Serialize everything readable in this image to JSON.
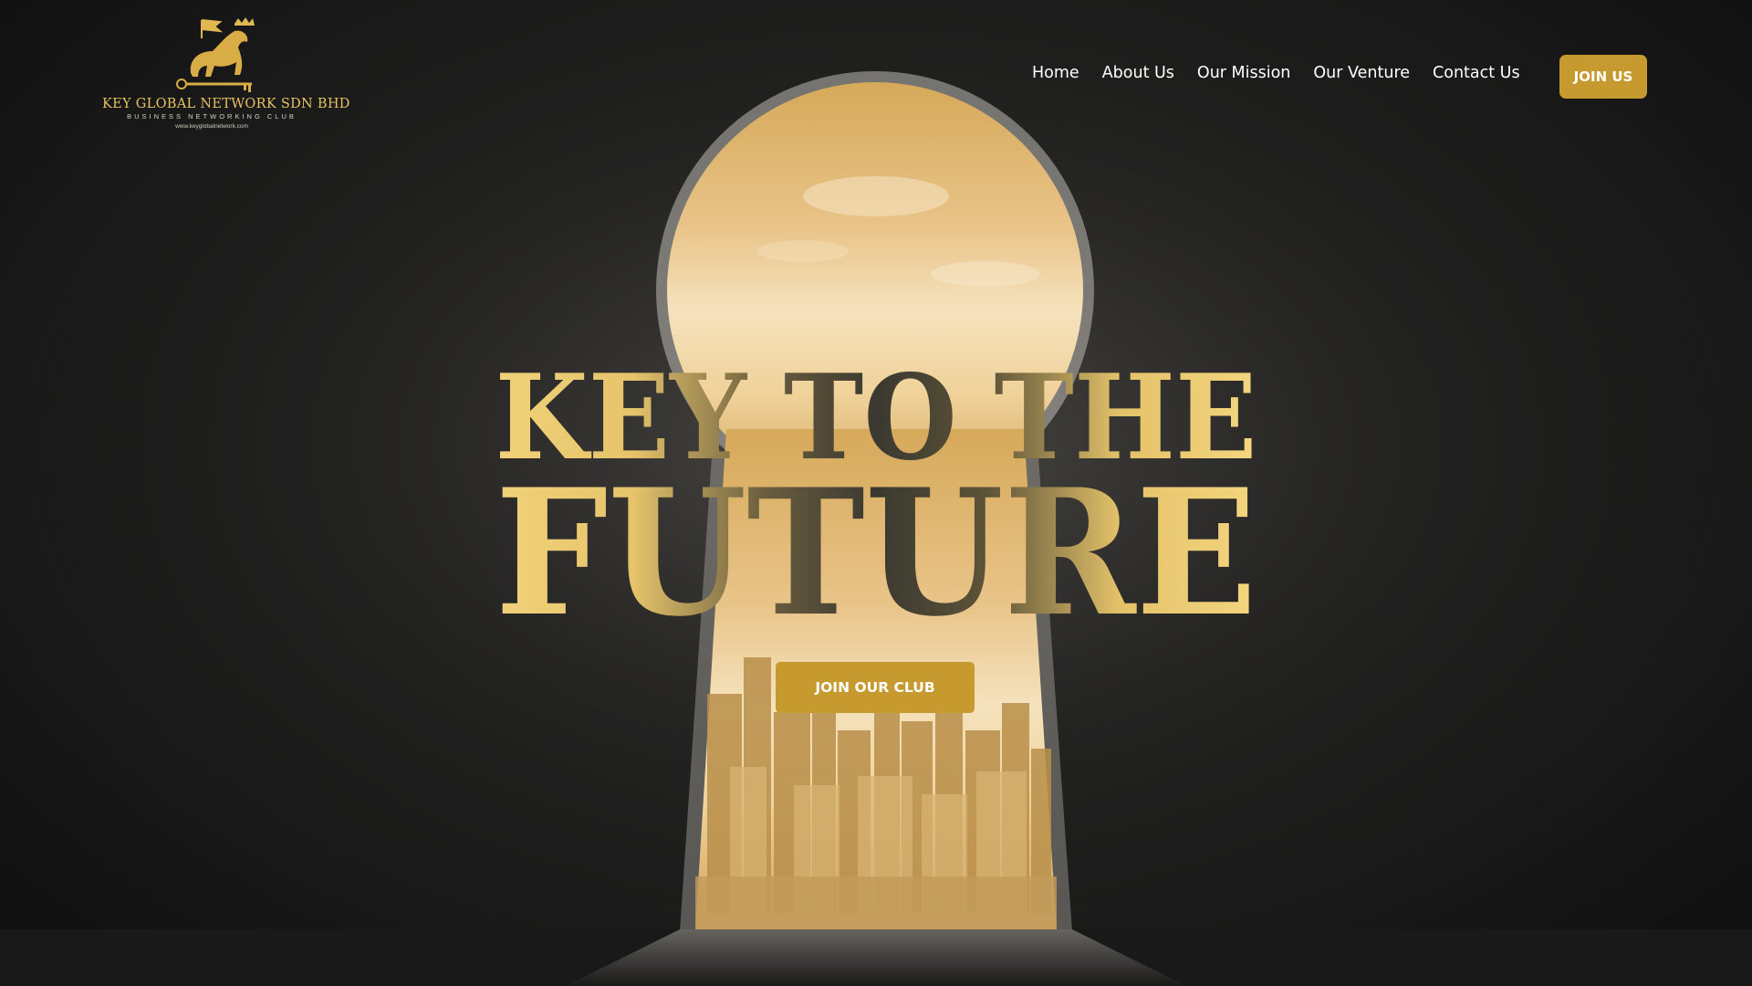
{
  "brand": {
    "name": "KEY GLOBAL NETWORK SDN BHD",
    "tagline": "BUSINESS NETWORKING CLUB",
    "url": "www.keyglobalnetwork.com",
    "logo_icon": "golden-horse-key-crown-icon"
  },
  "nav": {
    "items": [
      {
        "label": "Home"
      },
      {
        "label": "About Us"
      },
      {
        "label": "Our Mission"
      },
      {
        "label": "Our Venture"
      },
      {
        "label": "Contact Us"
      }
    ],
    "cta_label": "JOIN US"
  },
  "hero": {
    "headline_line1": "KEY TO THE",
    "headline_line2": "FUTURE",
    "cta_label": "JOIN OUR CLUB",
    "background": "keyhole-opening-city-skyline"
  },
  "colors": {
    "accent": "#c69a2e",
    "gold_light": "#f0d27a",
    "background_dark": "#1c1c1c"
  }
}
